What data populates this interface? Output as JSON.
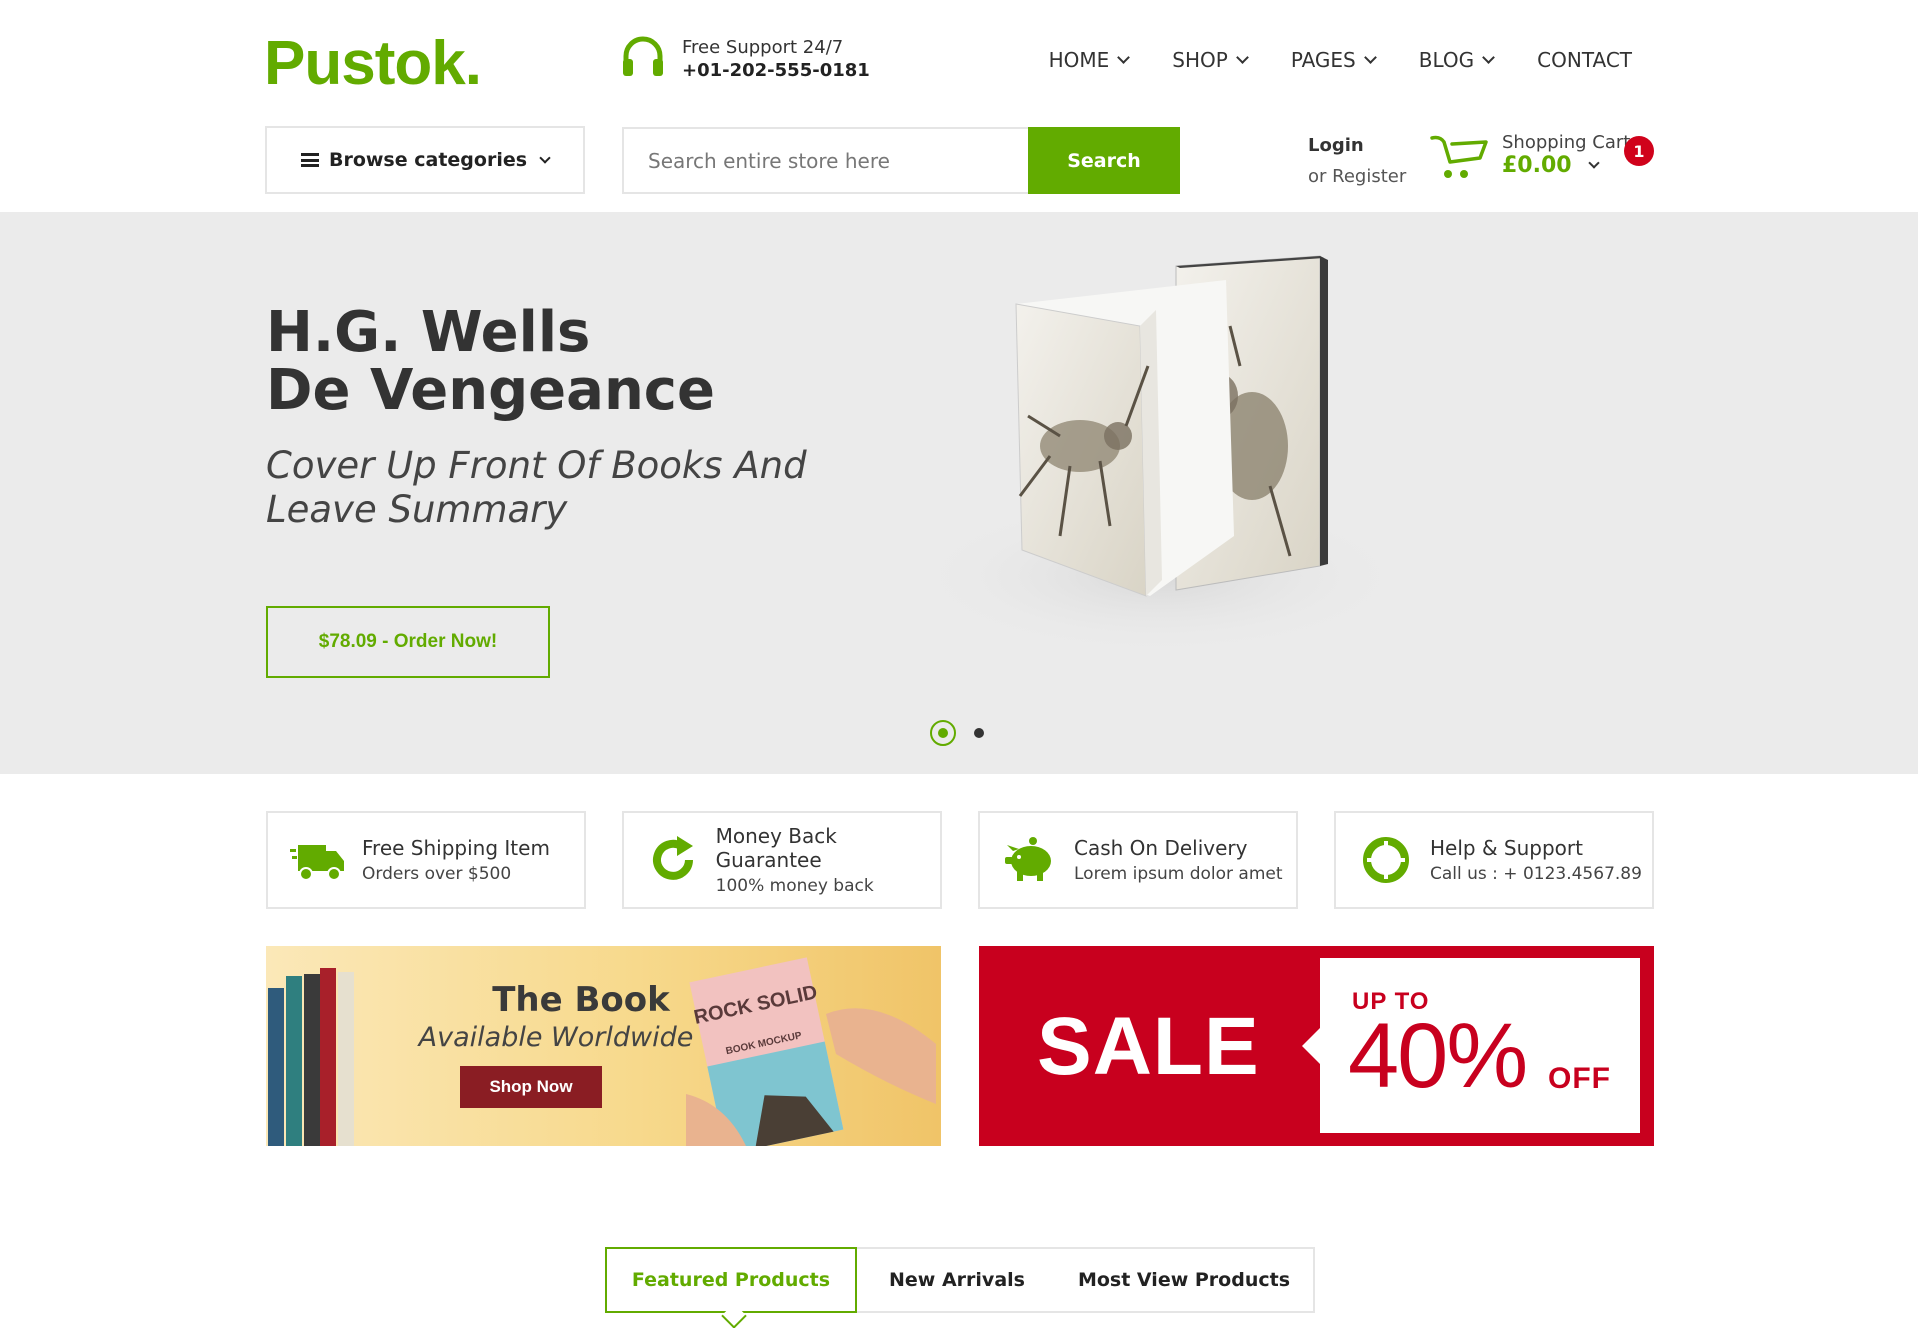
{
  "brand": {
    "logo": "Pustok.",
    "accent": "#62ab00",
    "sale_red": "#c8001e"
  },
  "support": {
    "line1": "Free Support 24/7",
    "phone": "+01-202-555-0181",
    "icon": "headphones-icon"
  },
  "nav": {
    "items": [
      {
        "label": "HOME",
        "has_dropdown": true
      },
      {
        "label": "SHOP",
        "has_dropdown": true
      },
      {
        "label": "PAGES",
        "has_dropdown": true
      },
      {
        "label": "BLOG",
        "has_dropdown": true
      },
      {
        "label": "CONTACT",
        "has_dropdown": false
      }
    ]
  },
  "browse": {
    "label": "Browse categories"
  },
  "search": {
    "placeholder": "Search entire store here",
    "value": "",
    "button": "Search"
  },
  "account": {
    "login": "Login",
    "register": "or Register"
  },
  "cart": {
    "label": "Shopping Cart",
    "total": "£0.00",
    "count": "1"
  },
  "hero": {
    "title_line1": "H.G. Wells",
    "title_line2": "De Vengeance",
    "subtitle": "Cover Up Front Of Books And Leave Summary",
    "button": "$78.09 - Order Now!",
    "slide_count": 2,
    "active_slide": 1
  },
  "features": [
    {
      "title": "Free Shipping Item",
      "sub": "Orders over $500",
      "icon": "truck-icon"
    },
    {
      "title": "Money Back Guarantee",
      "sub": "100% money back",
      "icon": "refresh-icon"
    },
    {
      "title": "Cash On Delivery",
      "sub": "Lorem ipsum dolor amet",
      "icon": "piggy-bank-icon"
    },
    {
      "title": "Help & Support",
      "sub": "Call us : + 0123.4567.89",
      "icon": "lifebuoy-icon"
    }
  ],
  "banner_book": {
    "title": "The Book",
    "sub": "Available Worldwide",
    "button": "Shop Now",
    "mockup_text": "ROCK SOLID",
    "mockup_sub": "BOOK MOCKUP"
  },
  "banner_sale": {
    "sale": "SALE",
    "upto": "UP TO",
    "percent": "40%",
    "off": "OFF"
  },
  "tabs": [
    {
      "label": "Featured Products",
      "active": true
    },
    {
      "label": "New Arrivals",
      "active": false
    },
    {
      "label": "Most View Products",
      "active": false
    }
  ]
}
